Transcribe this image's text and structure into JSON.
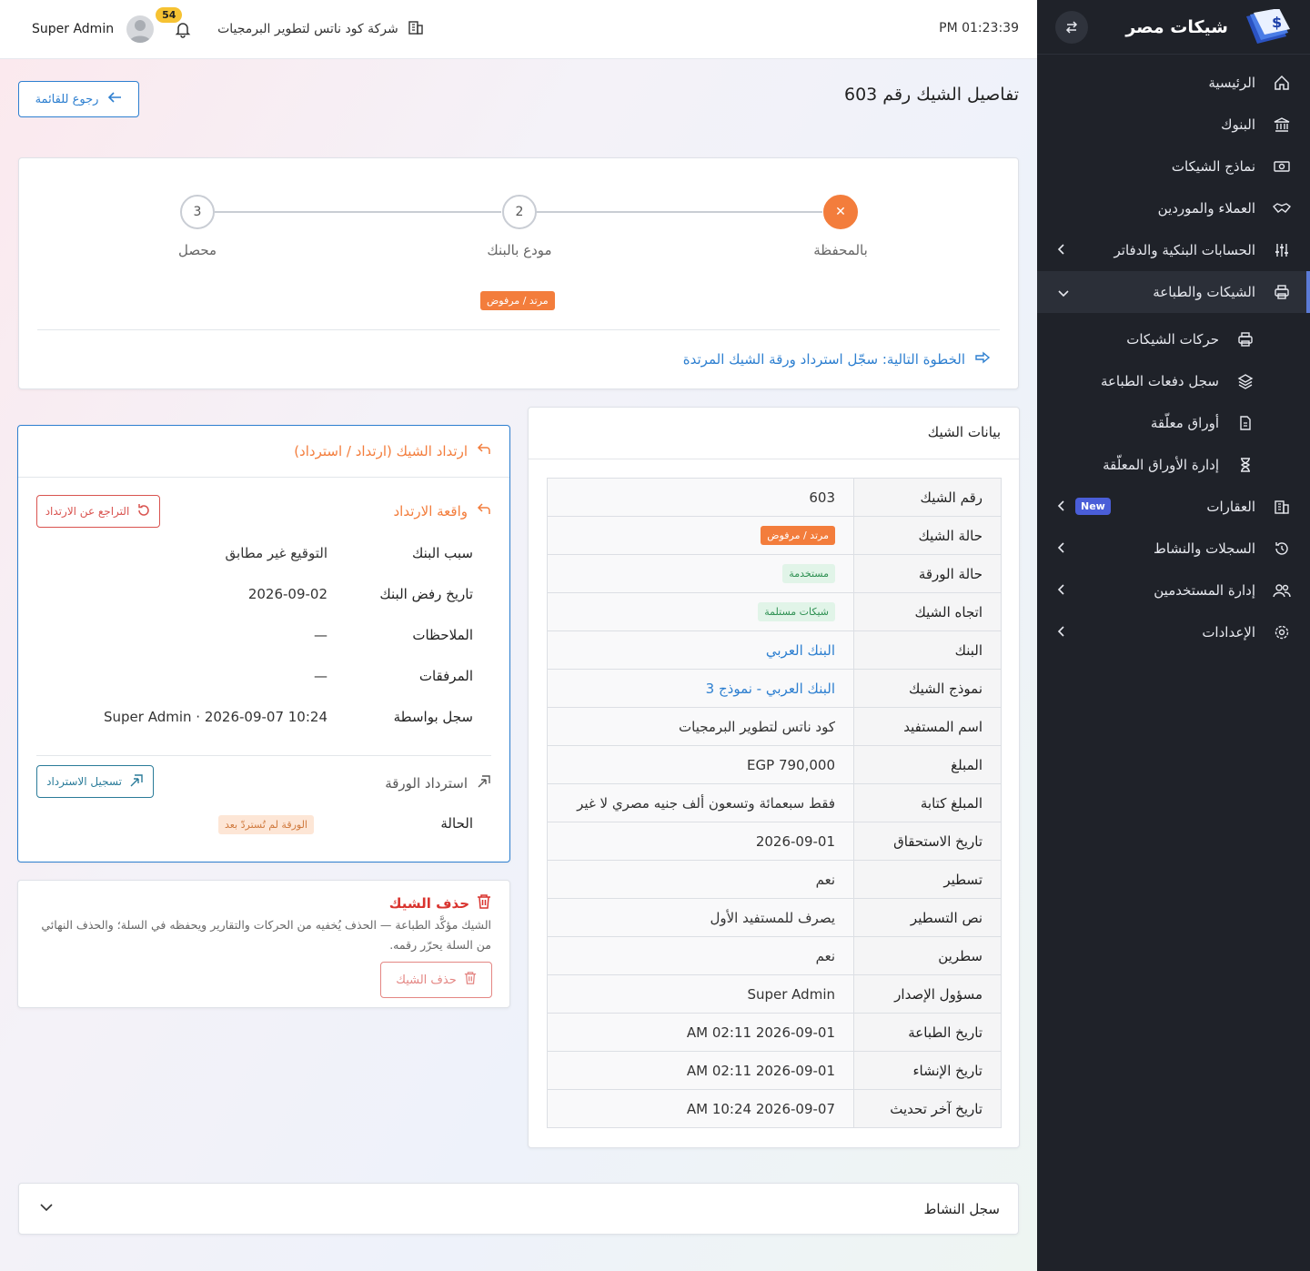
{
  "sidebar": {
    "brand": "شيكات مصر",
    "items": [
      {
        "label": "الرئيسية"
      },
      {
        "label": "البنوك"
      },
      {
        "label": "نماذج الشيكات"
      },
      {
        "label": "العملاء والموردين"
      },
      {
        "label": "الحسابات البنكية والدفاتر"
      },
      {
        "label": "الشيكات والطباعة"
      },
      {
        "label": "حركات الشيكات"
      },
      {
        "label": "سجل دفعات الطباعة"
      },
      {
        "label": "أوراق معلّقة"
      },
      {
        "label": "إدارة الأوراق المعلّقة"
      },
      {
        "label": "العقارات",
        "badge": "New"
      },
      {
        "label": "السجلات والنشاط"
      },
      {
        "label": "إدارة المستخدمين"
      },
      {
        "label": "الإعدادات"
      }
    ]
  },
  "topbar": {
    "clock": "PM 01:23:39",
    "company": "شركة كود ناتس لتطوير البرمجيات",
    "notifications": "54",
    "user": "Super Admin"
  },
  "page": {
    "title": "تفاصيل الشيك رقم 603",
    "back": "رجوع للقائمة"
  },
  "stepper": {
    "steps": [
      {
        "label": "بالمحفظة",
        "mark": "✕"
      },
      {
        "label": "مودع بالبنك",
        "mark": "2"
      },
      {
        "label": "محصل",
        "mark": "3"
      }
    ],
    "status_badge": "مرتد / مرفوض",
    "next_step": "الخطوة التالية: سجّل استرداد ورقة الشيك المرتدة"
  },
  "check_data": {
    "title": "بيانات الشيك",
    "rows": [
      {
        "k": "رقم الشيك",
        "v": "603"
      },
      {
        "k": "حالة الشيك",
        "v": "مرتد / مرفوض"
      },
      {
        "k": "حالة الورقة",
        "v": "مستخدمة"
      },
      {
        "k": "اتجاه الشيك",
        "v": "شيكات مستلمة"
      },
      {
        "k": "البنك",
        "v": "البنك العربي"
      },
      {
        "k": "نموذج الشيك",
        "v": "البنك العربي - نموذج 3"
      },
      {
        "k": "اسم المستفيد",
        "v": "كود ناتس لتطوير البرمجيات"
      },
      {
        "k": "المبلغ",
        "v": "EGP 790,000"
      },
      {
        "k": "المبلغ كتابة",
        "v": "فقط سبعمائة وتسعون ألف جنيه مصري لا غير"
      },
      {
        "k": "تاريخ الاستحقاق",
        "v": "2026-09-01"
      },
      {
        "k": "تسطير",
        "v": "نعم"
      },
      {
        "k": "نص التسطير",
        "v": "يصرف للمستفيد الأول"
      },
      {
        "k": "سطرين",
        "v": "نعم"
      },
      {
        "k": "مسؤول الإصدار",
        "v": "Super Admin"
      },
      {
        "k": "تاريخ الطباعة",
        "v": "AM 02:11 2026-09-01"
      },
      {
        "k": "تاريخ الإنشاء",
        "v": "AM 02:11 2026-09-01"
      },
      {
        "k": "تاريخ آخر تحديث",
        "v": "AM 10:24 2026-09-07"
      }
    ]
  },
  "bounce": {
    "title": "ارتداد الشيك (ارتداد / استرداد)",
    "event_title": "واقعة الارتداد",
    "undo": "التراجع عن الارتداد",
    "rows": [
      {
        "k": "سبب البنك",
        "v": "التوقيع غير مطابق"
      },
      {
        "k": "تاريخ رفض البنك",
        "v": "2026-09-02"
      },
      {
        "k": "الملاحظات",
        "v": "—"
      },
      {
        "k": "المرفقات",
        "v": "—"
      },
      {
        "k": "سجل بواسطة",
        "v": "Super Admin · 2026-09-07 10:24"
      }
    ],
    "paper_title": "استرداد الورقة",
    "register": "تسجيل الاسترداد",
    "status_label": "الحالة",
    "status_value": "الورقة لم تُستردّ بعد"
  },
  "delete": {
    "title": "حذف الشيك",
    "text": "الشيك مؤكَّد الطباعة — الحذف يُخفيه من الحركات والتقارير ويحفظه في السلة؛ والحذف النهائي من السلة يحرّر رقمه.",
    "button": "حذف الشيك"
  },
  "activity": {
    "title": "سجل النشاط"
  },
  "colors": {
    "accent": "#2d7fd0",
    "orange": "#f37d3c",
    "danger": "#d9342f",
    "sidebar": "#1f2229"
  }
}
